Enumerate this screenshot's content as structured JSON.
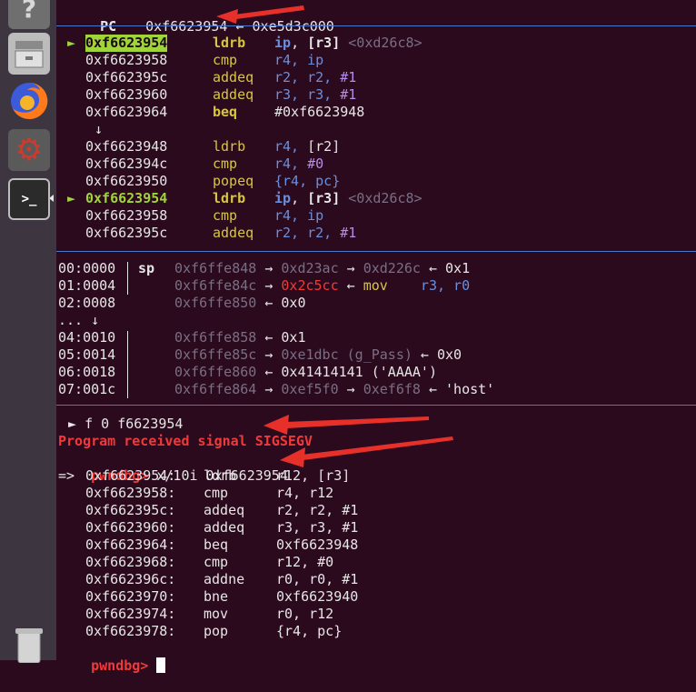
{
  "pc_header": {
    "label": "PC",
    "addr": "0xf6623954",
    "arrow": "←",
    "target": "0xe5d3c000"
  },
  "disasm": [
    {
      "marker": "►",
      "addr": "0xf6623954",
      "mnem": "ldrb",
      "ops": [
        {
          "t": "ip",
          "c": "blue-b"
        },
        {
          "t": ", ",
          "c": "white"
        },
        {
          "t": "[r3]",
          "c": "white-b"
        }
      ],
      "comment": "<0xd26c8>",
      "current": true
    },
    {
      "addr": "0xf6623958",
      "mnem": "cmp",
      "ops": [
        {
          "t": "r4, ip",
          "c": "blue"
        }
      ]
    },
    {
      "addr": "0xf662395c",
      "mnem": "addeq",
      "ops": [
        {
          "t": "r2, r2, ",
          "c": "blue"
        },
        {
          "t": "#1",
          "c": "purple"
        }
      ]
    },
    {
      "addr": "0xf6623960",
      "mnem": "addeq",
      "ops": [
        {
          "t": "r3, r3, ",
          "c": "blue"
        },
        {
          "t": "#1",
          "c": "purple"
        }
      ]
    },
    {
      "addr": "0xf6623964",
      "mnem": "beq",
      "ops": [
        {
          "t": "#0xf6623948",
          "c": "white"
        }
      ],
      "bold": true
    },
    {
      "down": "↓"
    },
    {
      "addr": "0xf6623948",
      "mnem": "ldrb",
      "ops": [
        {
          "t": "r4, ",
          "c": "blue"
        },
        {
          "t": "[r2]",
          "c": "white"
        }
      ]
    },
    {
      "addr": "0xf662394c",
      "mnem": "cmp",
      "ops": [
        {
          "t": "r4, ",
          "c": "blue"
        },
        {
          "t": "#0",
          "c": "purple"
        }
      ]
    },
    {
      "addr": "0xf6623950",
      "mnem": "popeq",
      "ops": [
        {
          "t": "{r4, pc}",
          "c": "blue"
        }
      ]
    },
    {
      "marker": "►",
      "addr": "0xf6623954",
      "mnem": "ldrb",
      "ops": [
        {
          "t": "ip",
          "c": "blue-b"
        },
        {
          "t": ", ",
          "c": "white"
        },
        {
          "t": "[r3]",
          "c": "white-b"
        }
      ],
      "comment": "<0xd26c8>",
      "current": true,
      "nohl": true
    },
    {
      "addr": "0xf6623958",
      "mnem": "cmp",
      "ops": [
        {
          "t": "r4, ip",
          "c": "blue"
        }
      ]
    },
    {
      "addr": "0xf662395c",
      "mnem": "addeq",
      "ops": [
        {
          "t": "r2, r2, ",
          "c": "blue"
        },
        {
          "t": "#1",
          "c": "purple"
        }
      ]
    }
  ],
  "stack": [
    {
      "idx": "00:0000",
      "reg": "sp",
      "parts": [
        {
          "t": "0xf6ffe848",
          "c": "grey"
        },
        {
          "t": " → ",
          "c": "white"
        },
        {
          "t": "0xd23ac",
          "c": "grey"
        },
        {
          "t": " → ",
          "c": "white"
        },
        {
          "t": "0xd226c",
          "c": "grey"
        },
        {
          "t": " ← ",
          "c": "white"
        },
        {
          "t": "0x1",
          "c": "white"
        }
      ]
    },
    {
      "idx": "01:0004",
      "reg": "",
      "parts": [
        {
          "t": "0xf6ffe84c",
          "c": "grey"
        },
        {
          "t": " → ",
          "c": "white"
        },
        {
          "t": "0x2c5cc",
          "c": "red"
        },
        {
          "t": " ← ",
          "c": "white"
        },
        {
          "t": "mov",
          "c": "yellow"
        },
        {
          "t": "    r3, r0",
          "c": "blue"
        }
      ]
    },
    {
      "idx": "02:0008",
      "reg": "",
      "parts": [
        {
          "t": "0xf6ffe850",
          "c": "grey"
        },
        {
          "t": " ← ",
          "c": "white"
        },
        {
          "t": "0x0",
          "c": "white"
        }
      ]
    },
    {
      "idx": "... ↓",
      "reg": "",
      "parts": [],
      "dots": true
    },
    {
      "idx": "04:0010",
      "reg": "",
      "parts": [
        {
          "t": "0xf6ffe858",
          "c": "grey"
        },
        {
          "t": " ← ",
          "c": "white"
        },
        {
          "t": "0x1",
          "c": "white"
        }
      ]
    },
    {
      "idx": "05:0014",
      "reg": "",
      "parts": [
        {
          "t": "0xf6ffe85c",
          "c": "grey"
        },
        {
          "t": " → ",
          "c": "white"
        },
        {
          "t": "0xe1dbc (g_Pass)",
          "c": "grey"
        },
        {
          "t": " ← ",
          "c": "white"
        },
        {
          "t": "0x0",
          "c": "white"
        }
      ]
    },
    {
      "idx": "06:0018",
      "reg": "",
      "parts": [
        {
          "t": "0xf6ffe860",
          "c": "grey"
        },
        {
          "t": " ← ",
          "c": "white"
        },
        {
          "t": "0x41414141 ('AAAA')",
          "c": "white"
        }
      ]
    },
    {
      "idx": "07:001c",
      "reg": "",
      "parts": [
        {
          "t": "0xf6ffe864",
          "c": "grey"
        },
        {
          "t": " → ",
          "c": "white"
        },
        {
          "t": "0xef5f0",
          "c": "grey"
        },
        {
          "t": " → ",
          "c": "white"
        },
        {
          "t": "0xef6f8",
          "c": "grey"
        },
        {
          "t": " ← ",
          "c": "white"
        },
        {
          "t": "'host'",
          "c": "white"
        }
      ]
    }
  ],
  "console": {
    "frame": " ► f 0 f6623954",
    "signal": "Program received signal SIGSEGV",
    "prompt": "pwndbg>",
    "command": " x/10i 0xf6623954",
    "dump": [
      {
        "pre": "=> ",
        "addr": "0xf6623954:",
        "mnem": "ldrb",
        "ops": "r12, [r3]"
      },
      {
        "pre": "   ",
        "addr": "0xf6623958:",
        "mnem": "cmp",
        "ops": "r4, r12"
      },
      {
        "pre": "   ",
        "addr": "0xf662395c:",
        "mnem": "addeq",
        "ops": "r2, r2, #1"
      },
      {
        "pre": "   ",
        "addr": "0xf6623960:",
        "mnem": "addeq",
        "ops": "r3, r3, #1"
      },
      {
        "pre": "   ",
        "addr": "0xf6623964:",
        "mnem": "beq",
        "ops": "0xf6623948"
      },
      {
        "pre": "   ",
        "addr": "0xf6623968:",
        "mnem": "cmp",
        "ops": "r12, #0"
      },
      {
        "pre": "   ",
        "addr": "0xf662396c:",
        "mnem": "addne",
        "ops": "r0, r0, #1"
      },
      {
        "pre": "   ",
        "addr": "0xf6623970:",
        "mnem": "bne",
        "ops": "0xf6623940"
      },
      {
        "pre": "   ",
        "addr": "0xf6623974:",
        "mnem": "mov",
        "ops": "r0, r12"
      },
      {
        "pre": "   ",
        "addr": "0xf6623978:",
        "mnem": "pop",
        "ops": "{r4, pc}"
      }
    ],
    "final_prompt": "pwndbg>"
  },
  "dock": [
    {
      "name": "help-icon",
      "glyph": "?"
    },
    {
      "name": "file-cabinet-icon",
      "glyph": "▭"
    },
    {
      "name": "firefox-icon",
      "glyph": ""
    },
    {
      "name": "settings-icon",
      "glyph": "⚙"
    },
    {
      "name": "terminal-icon",
      "glyph": ">_"
    },
    {
      "name": "trash-icon",
      "glyph": ""
    }
  ],
  "colors": {
    "accent_green": "#9fd43a",
    "signal_red": "#f03a3a",
    "separator_blue": "#4a77c8",
    "background": "#2c0a1e"
  }
}
